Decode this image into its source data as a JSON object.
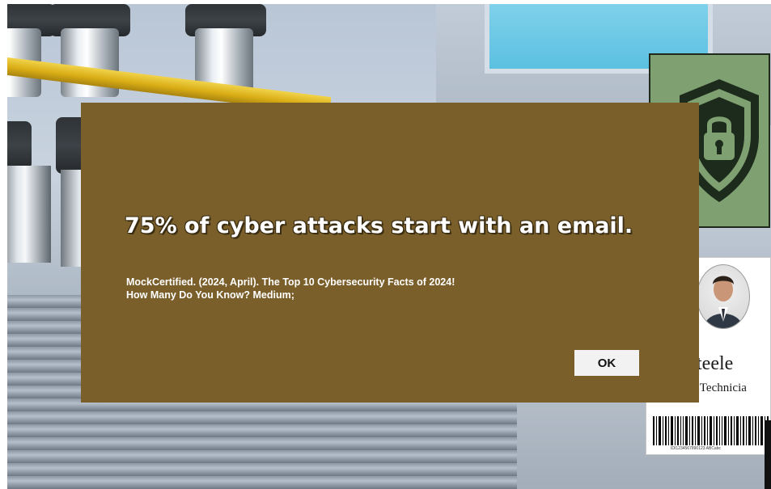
{
  "dialog": {
    "fact": "75% of cyber attacks start with an email.",
    "citation_line1": "MockCertified. (2024, April). The Top 10 Cybersecurity Facts of 2024!",
    "citation_line2": "How Many Do You Know? Medium;",
    "ok_label": "OK",
    "background_color": "#7b5f2a"
  },
  "badge": {
    "name": "an Steele",
    "title": "urity Technicia",
    "barcode_number": "IDI1234567890123 ABCabc"
  },
  "sign": {
    "icon": "shield-lock-icon",
    "background_color": "#7fa070"
  }
}
